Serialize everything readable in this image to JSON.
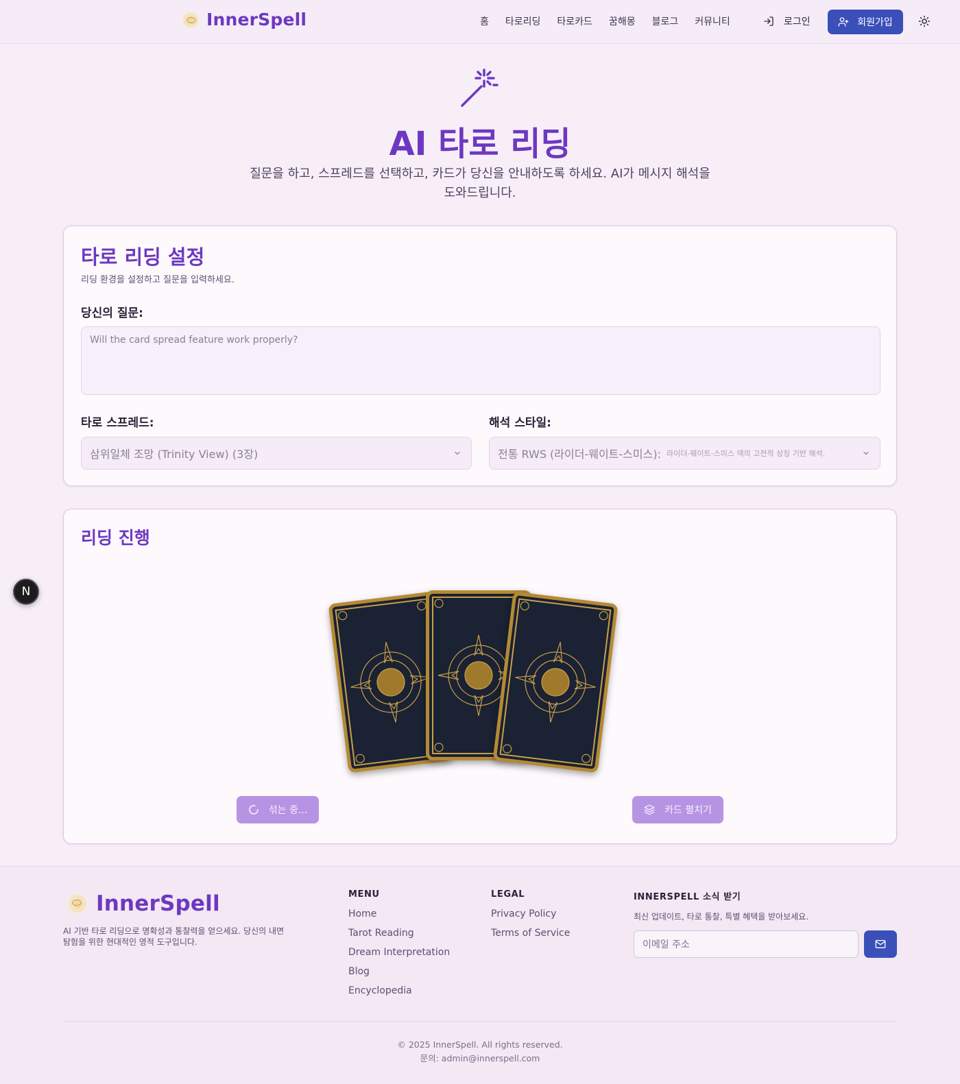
{
  "header": {
    "logo_text": "InnerSpell",
    "nav": [
      "홈",
      "타로리딩",
      "타로카드",
      "꿈해몽",
      "블로그",
      "커뮤니티"
    ],
    "login_label": "로그인",
    "signup_label": "회원가입"
  },
  "hero": {
    "title": "AI 타로 리딩",
    "subtitle": "질문을 하고, 스프레드를 선택하고, 카드가 당신을 안내하도록 하세요. AI가 메시지 해석을 도와드립니다."
  },
  "settings": {
    "title": "타로 리딩 설정",
    "description": "리딩 환경을 설정하고 질문을 입력하세요.",
    "question_label": "당신의 질문:",
    "question_placeholder": "Will the card spread feature work properly?",
    "spread_label": "타로 스프레드:",
    "spread_value": "삼위일체 조망 (Trinity View) (3장)",
    "style_label": "해석 스타일:",
    "style_value": "전통 RWS (라이더-웨이트-스미스):",
    "style_hint": "라이더-웨이트-스미스 덱의 고전적 상징 기반 해석."
  },
  "progress": {
    "title": "리딩 진행",
    "shuffle_label": "섞는 중...",
    "spread_label": "카드 펼치기"
  },
  "badge": {
    "letter": "N"
  },
  "footer": {
    "logo_text": "InnerSpell",
    "description": "AI 기반 타로 리딩으로 명확성과 통찰력을 얻으세요. 당신의 내면 탐험을 위한 현대적인 영적 도구입니다.",
    "menu_title": "MENU",
    "menu": [
      "Home",
      "Tarot Reading",
      "Dream Interpretation",
      "Blog",
      "Encyclopedia"
    ],
    "legal_title": "LEGAL",
    "legal": [
      "Privacy Policy",
      "Terms of Service"
    ],
    "newsletter_title": "INNERSPELL 소식 받기",
    "newsletter_desc": "최신 업데이트, 타로 통찰, 특별 혜택을 받아보세요.",
    "email_placeholder": "이메일 주소",
    "copyright": "© 2025 InnerSpell. All rights reserved.",
    "contact": "문의: admin@innerspell.com"
  },
  "colors": {
    "accent": "#6d38c1",
    "button": "#3b4fb8",
    "button_muted": "#b794e3"
  },
  "icons": [
    "logo-icon",
    "login-icon",
    "user-plus-icon",
    "sun-icon",
    "magic-wand-icon",
    "chevron-down-icon",
    "spinner-icon",
    "layers-icon",
    "mail-icon"
  ]
}
